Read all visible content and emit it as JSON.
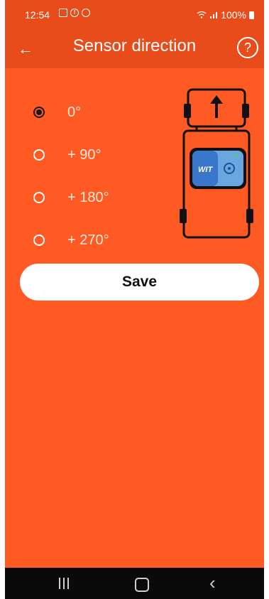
{
  "status_bar": {
    "time": "12:54",
    "battery": "100%"
  },
  "header": {
    "title": "Sensor direction",
    "back_icon": "arrow-left-icon",
    "help_icon": "question-circle-icon"
  },
  "options": [
    {
      "label": "0°",
      "selected": true
    },
    {
      "label": "+ 90°",
      "selected": false
    },
    {
      "label": "+ 180°",
      "selected": false
    },
    {
      "label": "+ 270°",
      "selected": false
    }
  ],
  "save_button": {
    "label": "Save"
  },
  "nav_bar": {
    "recent_icon": "recent-apps-icon",
    "home_icon": "home-icon",
    "back_icon": "chevron-left-icon"
  },
  "colors": {
    "background": "#ff5a24",
    "app_bar": "#e94c1b",
    "nav_bar": "#0a0a0a"
  }
}
